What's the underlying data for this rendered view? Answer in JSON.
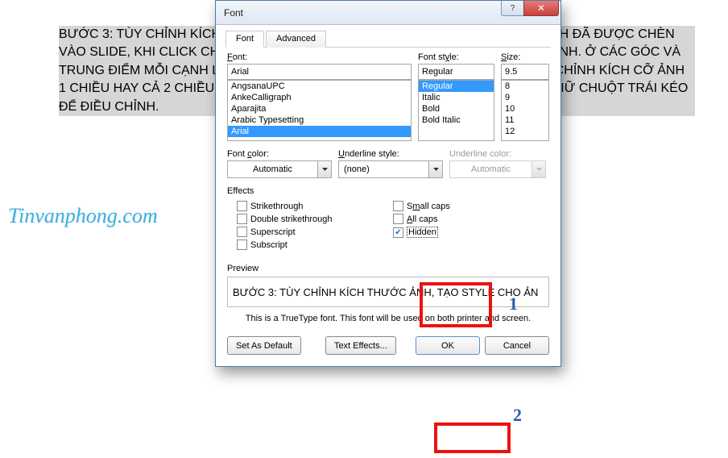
{
  "background_text": "BƯỚC 3: TÙY CHỈNH KÍCH THƯỚC ẢNH, TẠO STYLE CHO ẢNH. SAU KHI HÌNH ẢNH ĐÃ ĐƯỢC CHÈN VÀO SLIDE, KHI CLICK CHỌN ẢNH, BẠN SẼ THẤY CÓ MỘT KHUNG BAO QUANH ẢNH. Ở CÁC GÓC VÀ TRUNG ĐIỂM MỖI CẠNH LÀ CÓ MỘT NÚT HÌNH MŨI TÊN CONG CHO PHÉP ĐIỀU CHỈNH KÍCH CỠ ẢNH 1 CHIỀU HAY CẢ 2 CHIỀU, BẠN ĐƯA CHUỘT VÀO 1 TRONG 4 GÓC ẢNH BẤM VÀ GIỮ CHUỘT TRÁI KÉO ĐỂ ĐIỀU CHỈNH.",
  "watermark": "Tinvanphong.com",
  "dialog": {
    "title": "Font",
    "tabs": {
      "font": "Font",
      "advanced": "Advanced"
    },
    "font_label": "Font:",
    "font_value": "Arial",
    "font_list": [
      "AngsanaUPC",
      "AnkeCalligraph",
      "Aparajita",
      "Arabic Typesetting",
      "Arial"
    ],
    "style_label": "Font style:",
    "style_value": "Regular",
    "style_list": [
      "Regular",
      "Italic",
      "Bold",
      "Bold Italic"
    ],
    "size_label": "Size:",
    "size_value": "9.5",
    "size_list": [
      "8",
      "9",
      "10",
      "11",
      "12"
    ],
    "color_label": "Font color:",
    "color_value": "Automatic",
    "ul_style_label": "Underline style:",
    "ul_style_value": "(none)",
    "ul_color_label": "Underline color:",
    "ul_color_value": "Automatic",
    "effects_label": "Effects",
    "effects": {
      "strike": "Strikethrough",
      "dstrike": "Double strikethrough",
      "super": "Superscript",
      "sub": "Subscript",
      "smallcaps": "Small caps",
      "allcaps": "All caps",
      "hidden": "Hidden"
    },
    "preview_label": "Preview",
    "preview_text": "BƯỚC 3: TÙY CHỈNH KÍCH THƯỚC ẢNH, TẠO STYLE CHO ẢN",
    "note": "This is a TrueType font. This font will be used on both printer and screen.",
    "btn_default": "Set As Default",
    "btn_effects": "Text Effects...",
    "btn_ok": "OK",
    "btn_cancel": "Cancel"
  },
  "anno": {
    "one": "1",
    "two": "2"
  }
}
